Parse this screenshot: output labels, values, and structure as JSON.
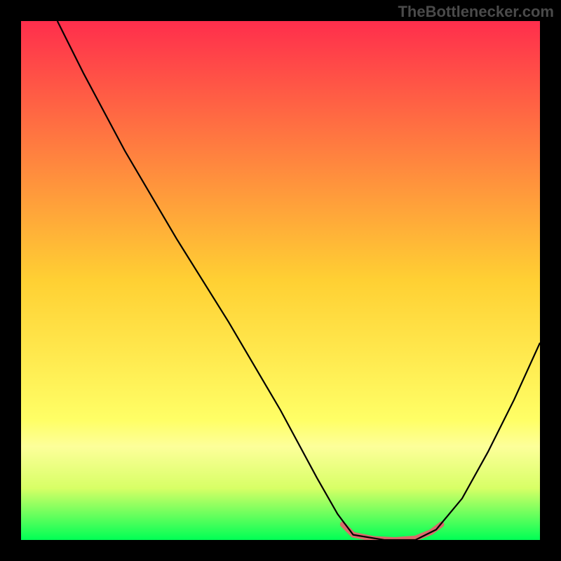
{
  "watermark": "TheBottlenecker.com",
  "chart_data": {
    "type": "line",
    "title": "",
    "xlabel": "",
    "ylabel": "",
    "xlim": [
      0,
      100
    ],
    "ylim": [
      0,
      100
    ],
    "gradient_stops": [
      {
        "offset": 0,
        "color": "#ff2e4c"
      },
      {
        "offset": 50,
        "color": "#ffd033"
      },
      {
        "offset": 77,
        "color": "#ffff66"
      },
      {
        "offset": 82,
        "color": "#fdff9a"
      },
      {
        "offset": 90,
        "color": "#d8ff66"
      },
      {
        "offset": 100,
        "color": "#00ff55"
      }
    ],
    "series": [
      {
        "name": "bottleneck-curve",
        "color": "#000000",
        "points": [
          {
            "x": 7,
            "y": 100
          },
          {
            "x": 12,
            "y": 90
          },
          {
            "x": 20,
            "y": 75
          },
          {
            "x": 30,
            "y": 58
          },
          {
            "x": 40,
            "y": 42
          },
          {
            "x": 50,
            "y": 25
          },
          {
            "x": 57,
            "y": 12
          },
          {
            "x": 61,
            "y": 5
          },
          {
            "x": 64,
            "y": 1
          },
          {
            "x": 70,
            "y": 0
          },
          {
            "x": 76,
            "y": 0
          },
          {
            "x": 80,
            "y": 2
          },
          {
            "x": 85,
            "y": 8
          },
          {
            "x": 90,
            "y": 17
          },
          {
            "x": 95,
            "y": 27
          },
          {
            "x": 100,
            "y": 38
          }
        ]
      },
      {
        "name": "optimal-range-highlight",
        "color": "#d96a6a",
        "stroke_width": 8,
        "points": [
          {
            "x": 62,
            "y": 3
          },
          {
            "x": 64,
            "y": 1
          },
          {
            "x": 68,
            "y": 0.2
          },
          {
            "x": 72,
            "y": 0
          },
          {
            "x": 76,
            "y": 0.3
          },
          {
            "x": 79,
            "y": 1.5
          },
          {
            "x": 81,
            "y": 3
          }
        ]
      }
    ]
  }
}
